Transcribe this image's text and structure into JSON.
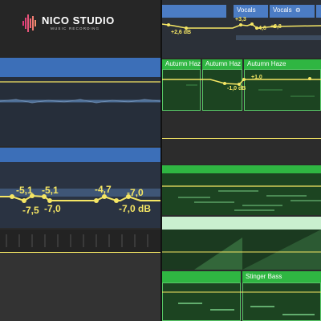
{
  "logo": {
    "title": "NICO STUDIO",
    "subtitle": "MUSIC RECORDING"
  },
  "regions": {
    "vocals_1": "Vocals",
    "vocals_2": "Vocals",
    "autumn_1": "Autumn Haz",
    "autumn_2": "Autumn Haz",
    "autumn_3": "Autumn Haze",
    "stinger": "Stinger Bass"
  },
  "automation": {
    "top_left": "+2,6 dB",
    "top_a": "+3,3",
    "top_b": "+4,6",
    "top_c": "+3,8",
    "mid_a": "+1,0",
    "mid_b": "-1,0 dB",
    "big": [
      "-5,1",
      "-5,1",
      "-7,5",
      "-7,0",
      "-4,7",
      "-7,0",
      "-7,0 dB"
    ]
  },
  "colors": {
    "automation": "#f5e664",
    "region_blue": "#3c6fb8",
    "region_green": "#2fb642",
    "background": "#2a2a2a"
  }
}
